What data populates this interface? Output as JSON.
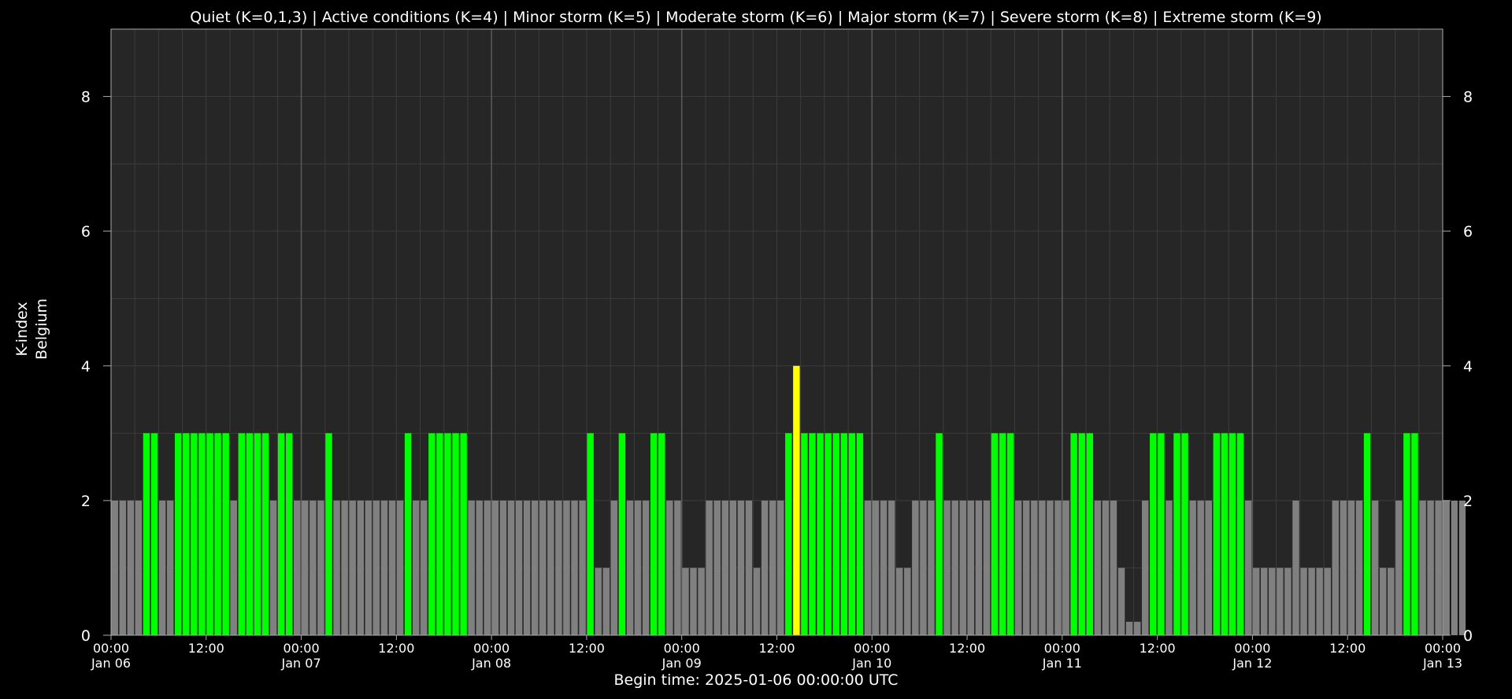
{
  "chart_data": {
    "type": "bar",
    "title": "Quiet (K=0,1,3) | Active conditions (K=4) | Minor storm (K=5) | Moderate storm (K=6) | Major storm (K=7) | Severe storm (K=8) | Extreme storm (K=9)",
    "ylabel_line1": "K-index",
    "ylabel_line2": "Belgium",
    "xlabel": "Begin time: 2025-01-06 00:00:00 UTC",
    "ylim": [
      0,
      9
    ],
    "yticks": [
      "0",
      "2",
      "4",
      "6",
      "8"
    ],
    "xticks": [
      {
        "hour": 0,
        "time": "00:00",
        "date": "Jan 06"
      },
      {
        "hour": 12,
        "time": "12:00",
        "date": ""
      },
      {
        "hour": 24,
        "time": "00:00",
        "date": "Jan 07"
      },
      {
        "hour": 36,
        "time": "12:00",
        "date": ""
      },
      {
        "hour": 48,
        "time": "00:00",
        "date": "Jan 08"
      },
      {
        "hour": 60,
        "time": "12:00",
        "date": ""
      },
      {
        "hour": 72,
        "time": "00:00",
        "date": "Jan 09"
      },
      {
        "hour": 84,
        "time": "12:00",
        "date": ""
      },
      {
        "hour": 96,
        "time": "00:00",
        "date": "Jan 10"
      },
      {
        "hour": 108,
        "time": "12:00",
        "date": ""
      },
      {
        "hour": 120,
        "time": "00:00",
        "date": "Jan 11"
      },
      {
        "hour": 132,
        "time": "12:00",
        "date": ""
      },
      {
        "hour": 144,
        "time": "00:00",
        "date": "Jan 12"
      },
      {
        "hour": 156,
        "time": "12:00",
        "date": ""
      },
      {
        "hour": 168,
        "time": "00:00",
        "date": "Jan 13"
      }
    ],
    "x_range_hours": [
      0,
      168
    ],
    "bar_interval_hours": 1,
    "values": [
      2,
      2,
      2,
      2,
      3,
      3,
      2,
      2,
      3,
      3,
      3,
      3,
      3,
      3,
      3,
      2,
      3,
      3,
      3,
      3,
      2,
      3,
      3,
      2,
      2,
      2,
      2,
      3,
      2,
      2,
      2,
      2,
      2,
      2,
      2,
      2,
      2,
      3,
      2,
      2,
      3,
      3,
      3,
      3,
      3,
      2,
      2,
      2,
      2,
      2,
      2,
      2,
      2,
      2,
      2,
      2,
      2,
      2,
      2,
      2,
      3,
      1,
      1,
      2,
      3,
      2,
      2,
      2,
      3,
      3,
      2,
      2,
      1,
      1,
      1,
      2,
      2,
      2,
      2,
      2,
      2,
      1,
      2,
      2,
      2,
      3,
      4,
      3,
      3,
      3,
      3,
      3,
      3,
      3,
      3,
      2,
      2,
      2,
      2,
      1,
      1,
      2,
      2,
      2,
      3,
      2,
      2,
      2,
      2,
      2,
      2,
      3,
      3,
      3,
      2,
      2,
      2,
      2,
      2,
      2,
      2,
      3,
      3,
      3,
      2,
      2,
      2,
      1,
      0.2,
      0.2,
      2,
      3,
      3,
      2,
      3,
      3,
      2,
      2,
      2,
      3,
      3,
      3,
      3,
      2,
      1,
      1,
      1,
      1,
      1,
      2,
      1,
      1,
      1,
      1,
      2,
      2,
      2,
      2,
      3,
      2,
      1,
      1,
      2,
      3,
      3,
      2,
      2,
      2,
      2,
      2,
      2
    ],
    "colors": {
      "quiet": "#808080",
      "k3": "#00ff00",
      "active": "#ffff00",
      "plot_bg": "#262626",
      "grid": "#3c3c3c",
      "day_grid": "#5a5a5a",
      "axis": "#aaaaaa",
      "page_bg": "#000000"
    },
    "grid": true
  }
}
